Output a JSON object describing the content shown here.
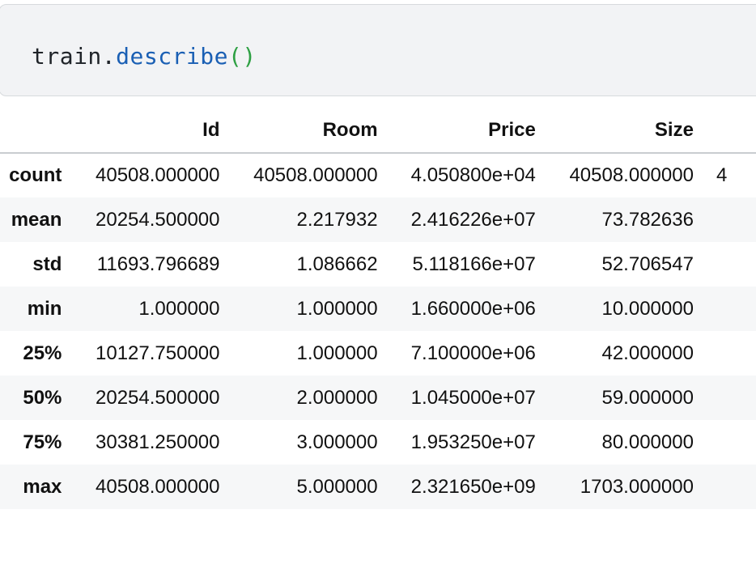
{
  "code": {
    "object": "train",
    "dot": ".",
    "method": "describe",
    "parens": "()"
  },
  "table": {
    "columns": [
      "Id",
      "Room",
      "Price",
      "Size"
    ],
    "rows": [
      {
        "label": "count",
        "values": [
          "40508.000000",
          "40508.000000",
          "4.050800e+04",
          "40508.000000"
        ],
        "extra": "4"
      },
      {
        "label": "mean",
        "values": [
          "20254.500000",
          "2.217932",
          "2.416226e+07",
          "73.782636"
        ]
      },
      {
        "label": "std",
        "values": [
          "11693.796689",
          "1.086662",
          "5.118166e+07",
          "52.706547"
        ]
      },
      {
        "label": "min",
        "values": [
          "1.000000",
          "1.000000",
          "1.660000e+06",
          "10.000000"
        ]
      },
      {
        "label": "25%",
        "values": [
          "10127.750000",
          "1.000000",
          "7.100000e+06",
          "42.000000"
        ]
      },
      {
        "label": "50%",
        "values": [
          "20254.500000",
          "2.000000",
          "1.045000e+07",
          "59.000000"
        ]
      },
      {
        "label": "75%",
        "values": [
          "30381.250000",
          "3.000000",
          "1.953250e+07",
          "80.000000"
        ]
      },
      {
        "label": "max",
        "values": [
          "40508.000000",
          "5.000000",
          "2.321650e+09",
          "1703.000000"
        ]
      }
    ]
  }
}
